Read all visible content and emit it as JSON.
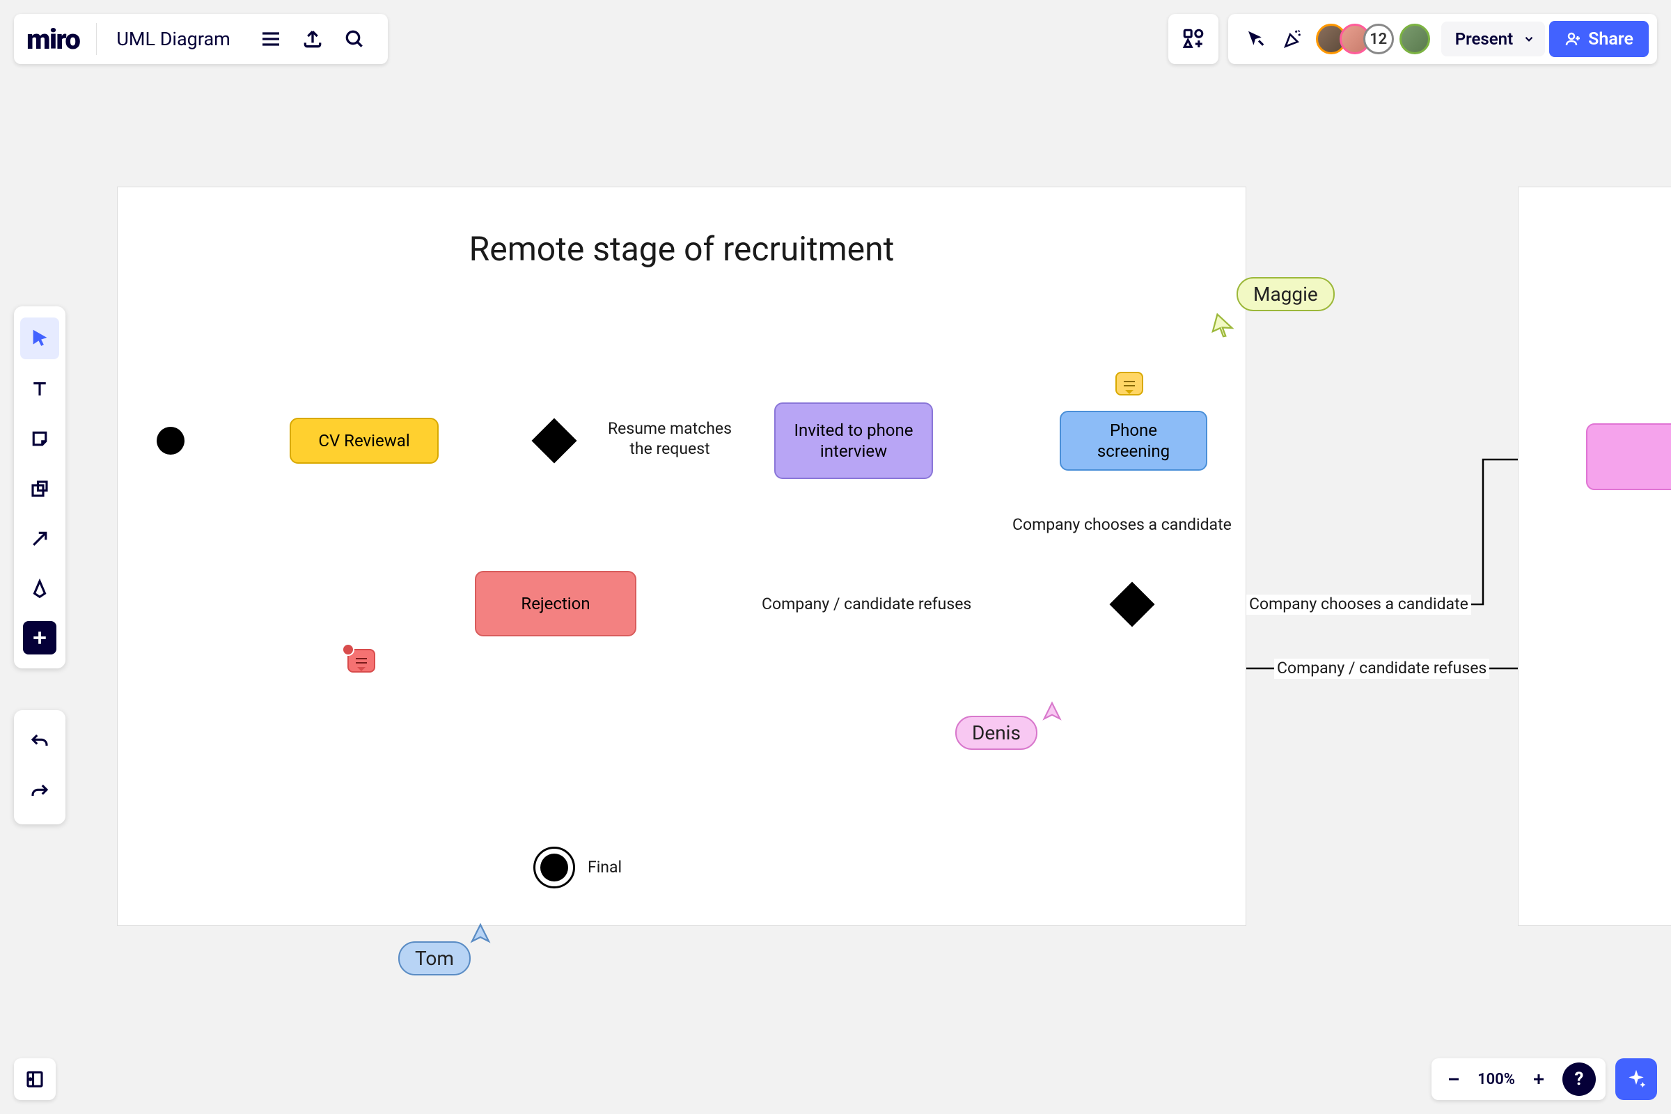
{
  "header": {
    "logo": "miro",
    "board_title": "UML Diagram",
    "present_label": "Present",
    "share_label": "Share",
    "avatar_overflow_count": "12"
  },
  "zoom": {
    "level": "100%"
  },
  "diagram": {
    "frame_title": "Remote stage of recruitment",
    "nodes": {
      "cv_reviewal": "CV Reviewal",
      "invited_phone": "Invited to phone interview",
      "phone_screening": "Phone screening",
      "rejection": "Rejection",
      "final": "Final"
    },
    "edges": {
      "resume_matches": "Resume matches the request",
      "company_chooses_1": "Company chooses a candidate",
      "company_refuses_1": "Company / candidate refuses",
      "company_chooses_2": "Company chooses a candidate",
      "company_refuses_2": "Company / candidate refuses"
    }
  },
  "cursors": {
    "maggie": "Maggie",
    "denis": "Denis",
    "tom": "Tom"
  },
  "colors": {
    "yellow_fill": "#ffd02f",
    "yellow_border": "#d9a900",
    "purple_fill": "#b8a5f5",
    "purple_border": "#8a76d8",
    "blue_fill": "#8cbcf7",
    "blue_border": "#4a8fd8",
    "red_fill": "#f38181",
    "red_border": "#d85c5c",
    "pink_fill": "#f5a3ec",
    "pink_border": "#e074d4",
    "maggie_fill": "#f2f9c4",
    "maggie_border": "#9cb83a",
    "denis_fill": "#f8c8f2",
    "denis_border": "#d878cc",
    "tom_fill": "#b8d4f5",
    "tom_border": "#5a8cc4",
    "comment_yellow": "#ffd666",
    "comment_red": "#f57272"
  }
}
